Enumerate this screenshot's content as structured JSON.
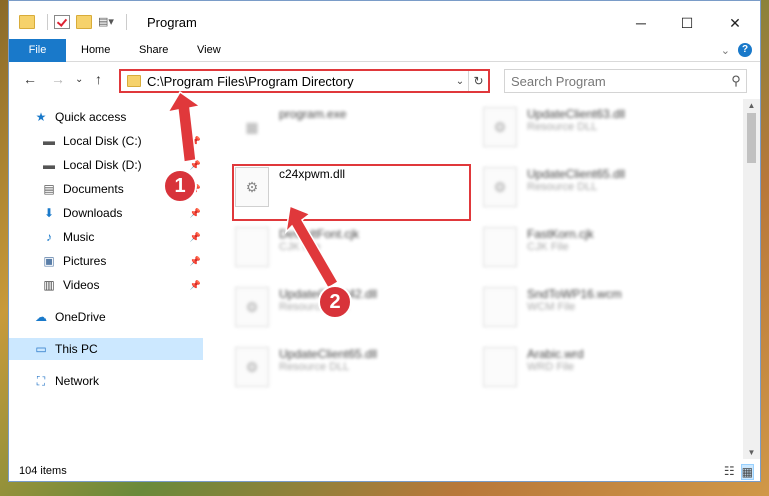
{
  "window": {
    "title": "Program"
  },
  "ribbon": {
    "tabs": [
      "File",
      "Home",
      "Share",
      "View"
    ]
  },
  "address": {
    "path": "C:\\Program Files\\Program Directory"
  },
  "search": {
    "placeholder": "Search Program"
  },
  "nav": {
    "items": [
      {
        "label": "Quick access",
        "icon": "star-icon",
        "pinned": false
      },
      {
        "label": "Local Disk (C:)",
        "icon": "drive-icon",
        "pinned": true
      },
      {
        "label": "Local Disk (D:)",
        "icon": "drive-icon",
        "pinned": true
      },
      {
        "label": "Documents",
        "icon": "documents-icon",
        "pinned": true
      },
      {
        "label": "Downloads",
        "icon": "download-icon",
        "pinned": true
      },
      {
        "label": "Music",
        "icon": "music-icon",
        "pinned": true
      },
      {
        "label": "Pictures",
        "icon": "pictures-icon",
        "pinned": true
      },
      {
        "label": "Videos",
        "icon": "videos-icon",
        "pinned": true
      },
      {
        "label": "OneDrive",
        "icon": "cloud-icon",
        "pinned": false
      },
      {
        "label": "This PC",
        "icon": "computer-icon",
        "pinned": false,
        "selected": true
      },
      {
        "label": "Network",
        "icon": "network-icon",
        "pinned": false
      }
    ]
  },
  "files": [
    {
      "name": "program.exe",
      "desc": "",
      "blurred": true
    },
    {
      "name": "UpdateClient63.dll",
      "desc": "Resource DLL",
      "blurred": true
    },
    {
      "name": "c24xpwm.dll",
      "desc": "",
      "blurred": false,
      "highlighted": true
    },
    {
      "name": "UpdateClient65.dll",
      "desc": "Resource DLL",
      "blurred": true
    },
    {
      "name": "DefaultFont.cjk",
      "desc": "CJK File",
      "blurred": true
    },
    {
      "name": "FastKorn.cjk",
      "desc": "CJK File",
      "blurred": true
    },
    {
      "name": "UpdateClient42.dll",
      "desc": "Resource DLL",
      "blurred": true
    },
    {
      "name": "SndToWP16.wcm",
      "desc": "WCM File",
      "blurred": true
    },
    {
      "name": "UpdateClient65.dll",
      "desc": "Resource DLL",
      "blurred": true
    },
    {
      "name": "Arabic.wrd",
      "desc": "WRD File",
      "blurred": true
    }
  ],
  "status": {
    "items_count": "104 items"
  },
  "annotations": {
    "step1": "1",
    "step2": "2"
  },
  "colors": {
    "accent": "#1979ca",
    "highlight": "#e0383b"
  }
}
